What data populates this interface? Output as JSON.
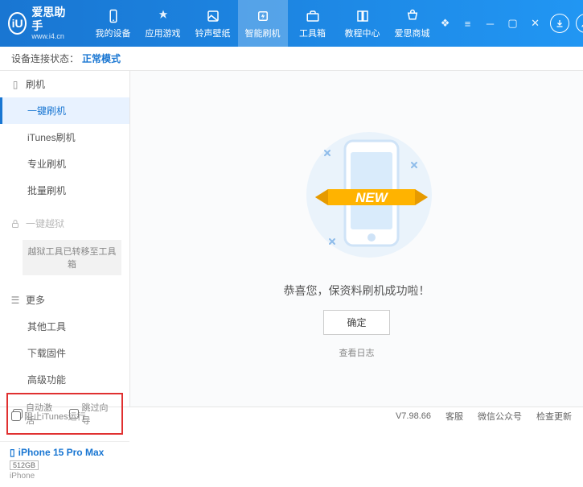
{
  "app": {
    "name": "爱思助手",
    "url": "www.i4.cn",
    "logo_text": "iU"
  },
  "nav": {
    "items": [
      {
        "label": "我的设备"
      },
      {
        "label": "应用游戏"
      },
      {
        "label": "铃声壁纸"
      },
      {
        "label": "智能刷机"
      },
      {
        "label": "工具箱"
      },
      {
        "label": "教程中心"
      },
      {
        "label": "爱思商城"
      }
    ]
  },
  "status": {
    "label": "设备连接状态：",
    "mode": "正常模式"
  },
  "sidebar": {
    "flash_section": "刷机",
    "flash_items": [
      "一键刷机",
      "iTunes刷机",
      "专业刷机",
      "批量刷机"
    ],
    "jailbreak_section": "一键越狱",
    "jailbreak_note": "越狱工具已转移至工具箱",
    "more_section": "更多",
    "more_items": [
      "其他工具",
      "下载固件",
      "高级功能"
    ],
    "chk_auto": "自动激活",
    "chk_skip": "跳过向导"
  },
  "device": {
    "name": "iPhone 15 Pro Max",
    "storage": "512GB",
    "type": "iPhone"
  },
  "main": {
    "ribbon": "NEW",
    "message": "恭喜您，保资料刷机成功啦！",
    "ok": "确定",
    "log": "查看日志"
  },
  "footer": {
    "block_itunes": "阻止iTunes运行",
    "version": "V7.98.66",
    "support": "客服",
    "wechat": "微信公众号",
    "update": "检查更新"
  }
}
